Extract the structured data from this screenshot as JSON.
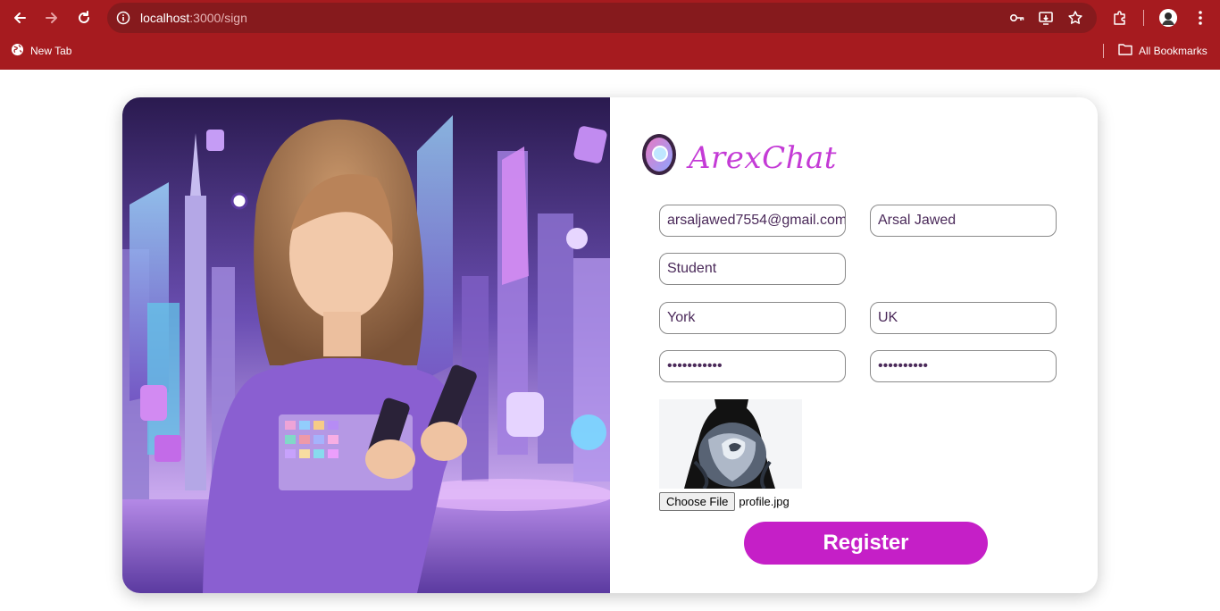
{
  "browser": {
    "url_host": "localhost",
    "url_path": ":3000/sign",
    "bookmarks": {
      "new_tab": "New Tab",
      "all_bookmarks": "All Bookmarks"
    },
    "colors": {
      "frame": "#a61b1f",
      "omnibox": "#861a1d"
    }
  },
  "app": {
    "brand_name": "ArexChat",
    "form": {
      "email": "arsaljawed7554@gmail.com",
      "name": "Arsal Jawed",
      "occupation": "Student",
      "city": "York",
      "country": "UK",
      "password": "•••••••••••",
      "confirm_password": "••••••••••",
      "choose_file_label": "Choose File",
      "file_name": "profile.jpg",
      "register_label": "Register"
    },
    "colors": {
      "accent": "#c51fc7",
      "brand_text": "#c43bd6"
    }
  },
  "icons": {
    "back": "back-arrow-icon",
    "forward": "forward-arrow-icon",
    "reload": "reload-icon",
    "info": "site-info-icon",
    "key": "password-key-icon",
    "install": "install-app-icon",
    "star": "bookmark-star-icon",
    "extensions": "extensions-icon",
    "menu": "kebab-menu-icon",
    "globe": "globe-icon",
    "folder": "folder-icon"
  }
}
